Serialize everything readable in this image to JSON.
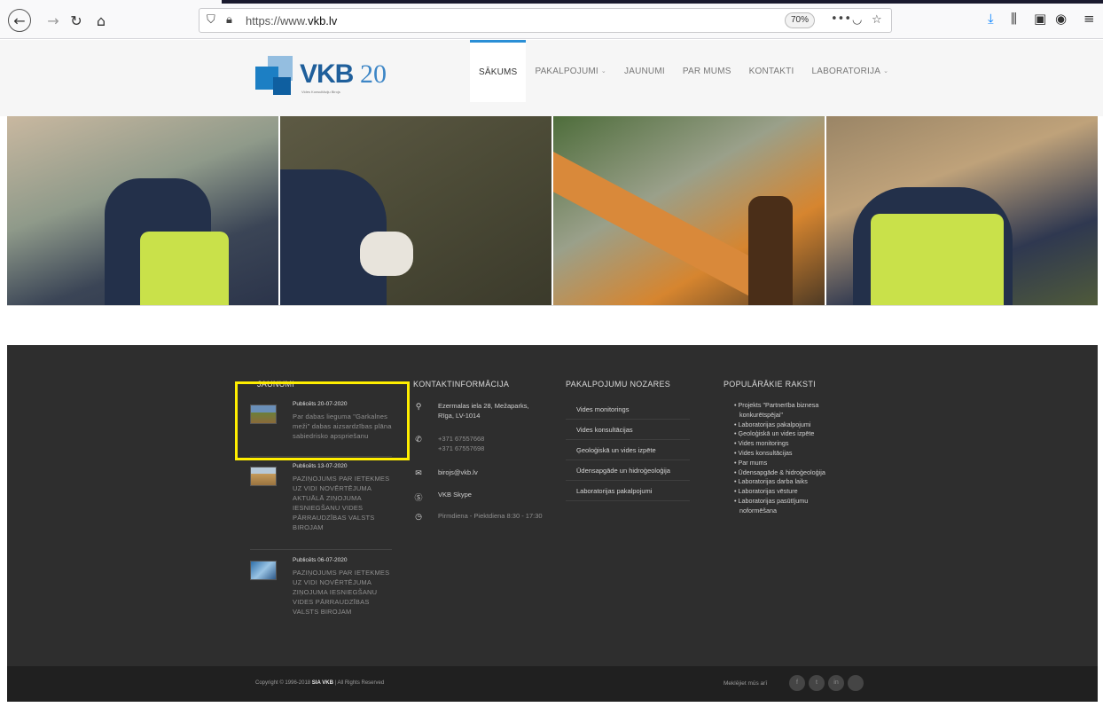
{
  "browser": {
    "url_prefix": "https://www.",
    "url_domain": "vkb.lv",
    "zoom": "70%",
    "more_label": "•••"
  },
  "logo": {
    "brand": "VKB",
    "number": "20",
    "tagline": "Vides Konsultāciju Birojs"
  },
  "menu": [
    {
      "label": "SĀKUMS",
      "active": true,
      "has_dropdown": false
    },
    {
      "label": "PAKALPOJUMI",
      "active": false,
      "has_dropdown": true
    },
    {
      "label": "JAUNUMI",
      "active": false,
      "has_dropdown": false
    },
    {
      "label": "PAR MUMS",
      "active": false,
      "has_dropdown": false
    },
    {
      "label": "KONTAKTI",
      "active": false,
      "has_dropdown": false
    },
    {
      "label": "LABORATORIJA",
      "active": false,
      "has_dropdown": true
    }
  ],
  "footer": {
    "news_title": "JAUNUMI",
    "news": [
      {
        "date": "Publicēts 20-07-2020",
        "title": "Par dabas lieguma \"Garkalnes meži\" dabas aizsardzības plāna sabiedrisko apspriešanu"
      },
      {
        "date": "Publicēts 13-07-2020",
        "title": "PAZIŅOJUMS PAR IETEKMES UZ VIDI NOVĒRTĒJUMA AKTUĀLĀ ZIŅOJUMA IESNIEGŠANU VIDES PĀRRAUDZĪBAS VALSTS BIROJAM"
      },
      {
        "date": "Publicēts 06-07-2020",
        "title": "PAZIŅOJUMS PAR IETEKMES UZ VIDI NOVĒRTĒJUMA ZIŅOJUMA IESNIEGŠANU VIDES PĀRRAUDZĪBAS VALSTS BIROJAM"
      }
    ],
    "contact_title": "KONTAKTINFORMĀCIJA",
    "contact": {
      "address_line1": "Ezermalas iela 28, Mežaparks,",
      "address_line2": "Rīga, LV-1014",
      "phone1": "+371 67557668",
      "phone2": "+371 67557698",
      "email": "birojs@vkb.lv",
      "skype": "VKB Skype",
      "hours": "Pirmdiena - Piektdiena 8:30 - 17:30"
    },
    "services_title": "PAKALPOJUMU NOZARES",
    "services": [
      "Vides monitorings",
      "Vides konsultācijas",
      "Ģeoloģiskā un vides izpēte",
      "Ūdensapgāde un hidroģeoloģija",
      "Laboratorijas pakalpojumi"
    ],
    "popular_title": "POPULĀRĀKIE RAKSTI",
    "popular": [
      "Projekts \"Partnerība biznesa",
      "konkurētspējai\"",
      "Laboratorijas pakalpojumi",
      "Ģeoloģiskā un vides izpēte",
      "Vides monitorings",
      "Vides konsultācijas",
      "Par mums",
      "Ūdensapgāde & hidroģeoloģija",
      "Laboratorijas darba laiks",
      "Laboratorijas vēsture",
      "Laboratorijas pasūtījumu",
      "noformēšana"
    ],
    "copyright_prefix": "Copyright © 1996-2018 ",
    "copyright_company": "SIA VKB",
    "copyright_suffix": "  |  All Rights Reserved",
    "follow_label": "Meklējiet mūs arī",
    "social": [
      "f",
      "t",
      "in",
      ""
    ]
  },
  "colors": {
    "accent": "#2a8fd6",
    "footer_bg": "#2e2e2e",
    "highlight": "#ffee00"
  }
}
